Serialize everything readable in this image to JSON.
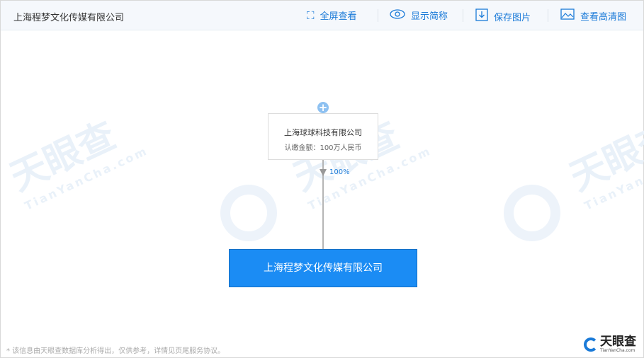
{
  "header": {
    "title": "上海程梦文化传媒有限公司",
    "tools": [
      {
        "label": "全屏查看",
        "icon": "fullscreen-icon"
      },
      {
        "label": "显示简称",
        "icon": "eye-icon"
      },
      {
        "label": "保存图片",
        "icon": "download-icon"
      },
      {
        "label": "查看高清图",
        "icon": "image-icon"
      }
    ]
  },
  "shareholder": {
    "name": "上海球球科技有限公司",
    "amount": "认缴金额：100万人民币",
    "percent": "100%"
  },
  "company": {
    "name": "上海程梦文化传媒有限公司"
  },
  "footer": {
    "note": "* 该信息由天眼查数据库分析得出，仅供参考，详情见页尾服务协议。",
    "logo_text": "天眼查",
    "logo_sub": "TianYanCha.com"
  },
  "watermark": {
    "text": "天眼查",
    "sub": "TianYanCha.com"
  }
}
